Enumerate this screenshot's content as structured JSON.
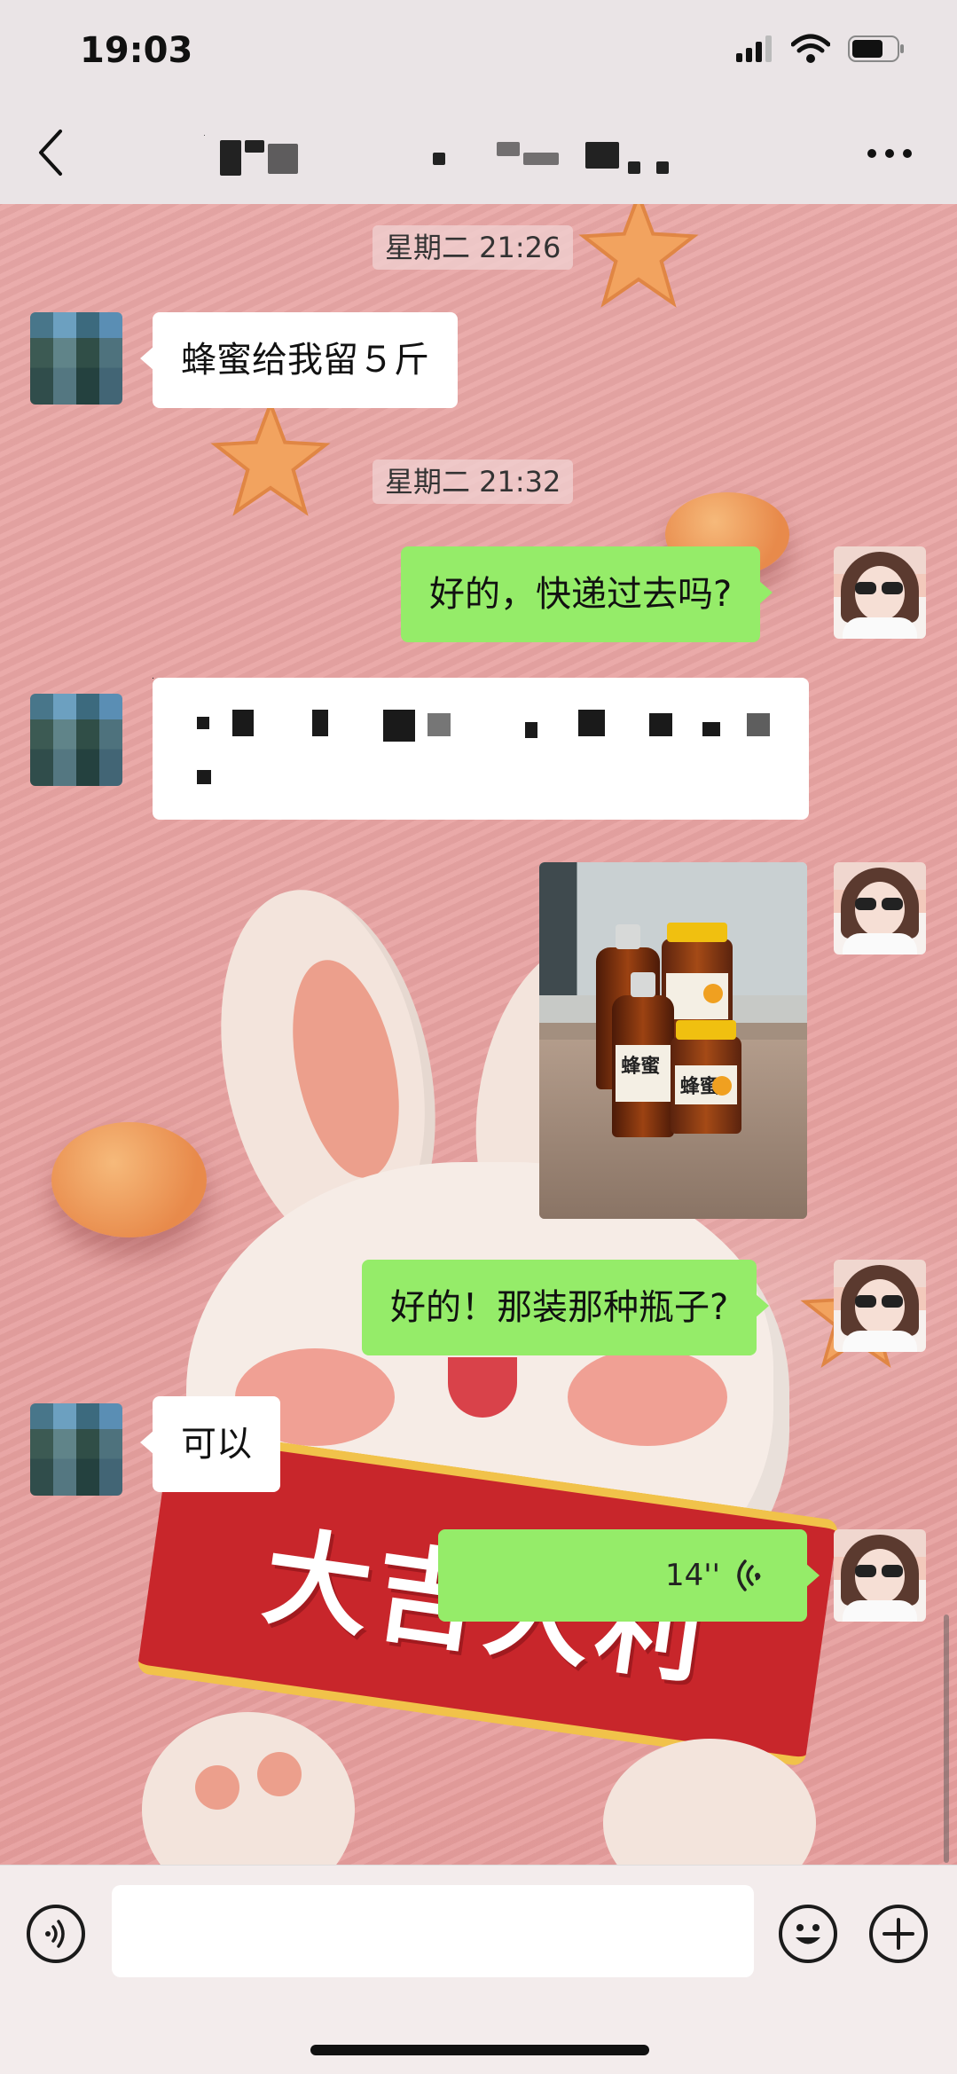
{
  "status_bar": {
    "time": "19:03"
  },
  "header": {
    "title": "████ ██ ███ ██"
  },
  "messages": [
    {
      "type": "timestamp",
      "text": "星期二 21:26"
    },
    {
      "type": "text",
      "side": "left",
      "text": "蜂蜜给我留５斤"
    },
    {
      "type": "timestamp",
      "text": "星期二 21:32"
    },
    {
      "type": "text",
      "side": "right",
      "text": "好的，快递过去吗?"
    },
    {
      "type": "text",
      "side": "left",
      "text": "████████████████"
    },
    {
      "type": "image",
      "side": "right",
      "labels": [
        "蜂蜜",
        "蜂蜜",
        "蜂蜜"
      ]
    },
    {
      "type": "text",
      "side": "right",
      "text": "好的！那装那种瓶子?"
    },
    {
      "type": "text",
      "side": "left",
      "text": "可以"
    },
    {
      "type": "voice",
      "side": "right",
      "duration": "14''"
    }
  ],
  "background_art": {
    "banner_text": "大吉大利"
  },
  "input_bar": {
    "placeholder": ""
  },
  "colors": {
    "sent_bubble": "#95ec69",
    "received_bubble": "#ffffff",
    "header_bg": "#eae4e6",
    "chat_bg": "#e9a6a6"
  },
  "icons": [
    "back-icon",
    "more-icon",
    "voice-mode-icon",
    "emoji-icon",
    "plus-icon",
    "voice-wave-icon",
    "signal-icon",
    "wifi-icon",
    "battery-icon"
  ]
}
